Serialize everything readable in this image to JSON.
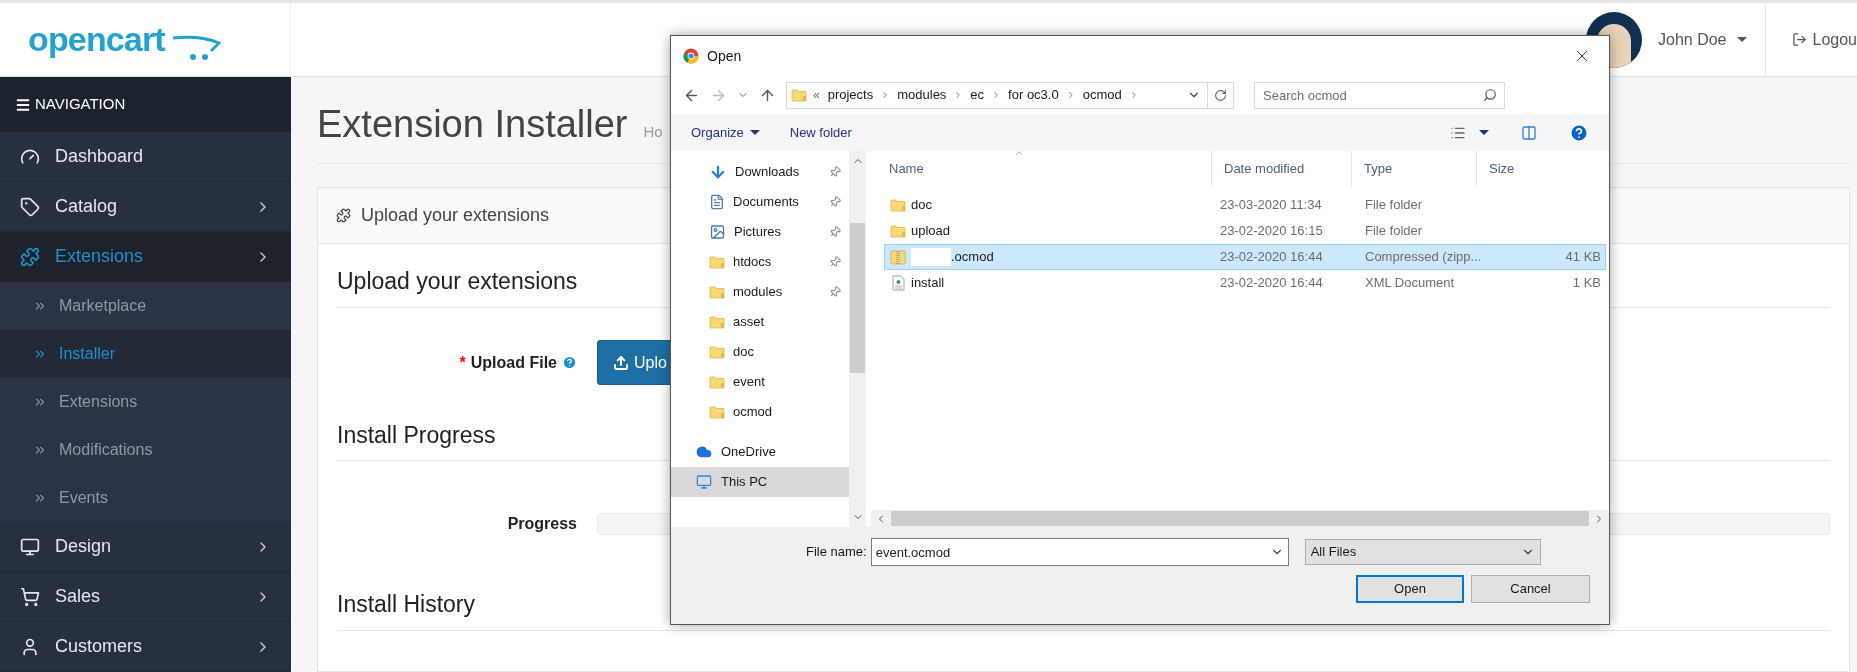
{
  "logo": {
    "text": "opencart"
  },
  "header": {
    "user": "John Doe",
    "logout": "Logou"
  },
  "sidebar": {
    "title": "NAVIGATION",
    "items": [
      {
        "label": "Dashboard",
        "kind": "dashboard",
        "has_submenu": false,
        "selected": false
      },
      {
        "label": "Catalog",
        "kind": "tag",
        "has_submenu": true,
        "selected": false
      },
      {
        "label": "Extensions",
        "kind": "puzzle",
        "has_submenu": true,
        "selected": true,
        "children": [
          {
            "label": "Marketplace",
            "selected": false
          },
          {
            "label": "Installer",
            "selected": true
          },
          {
            "label": "Extensions",
            "selected": false
          },
          {
            "label": "Modifications",
            "selected": false
          },
          {
            "label": "Events",
            "selected": false
          }
        ]
      },
      {
        "label": "Design",
        "kind": "monitor",
        "has_submenu": true,
        "selected": false
      },
      {
        "label": "Sales",
        "kind": "cart",
        "has_submenu": true,
        "selected": false
      },
      {
        "label": "Customers",
        "kind": "user",
        "has_submenu": true,
        "selected": false
      }
    ]
  },
  "page": {
    "title": "Extension Installer",
    "breadcrumb": "Ho",
    "panel_title": "Upload your extensions",
    "upload": {
      "legend": "Upload your extensions",
      "label": "Upload File",
      "required_mark": "*",
      "button": "Uplo"
    },
    "progress": {
      "legend": "Install Progress",
      "label": "Progress",
      "level": 0
    },
    "history": {
      "legend": "Install History"
    }
  },
  "dialog": {
    "title": "Open",
    "overflow_mark": "«",
    "path": [
      "projects",
      "modules",
      "ec",
      "for oc3.0",
      "ocmod"
    ],
    "search": {
      "placeholder": "Search ocmod"
    },
    "toolbar": [
      "Organize",
      "New folder"
    ],
    "nav": [
      {
        "label": "Downloads",
        "kind": "download",
        "pinned": true,
        "selected": false
      },
      {
        "label": "Documents",
        "kind": "documents",
        "pinned": true,
        "selected": false
      },
      {
        "label": "Pictures",
        "kind": "pictures",
        "pinned": true,
        "selected": false
      },
      {
        "label": "htdocs",
        "kind": "folder",
        "pinned": true,
        "selected": false
      },
      {
        "label": "modules",
        "kind": "folder",
        "pinned": true,
        "selected": false
      },
      {
        "label": "asset",
        "kind": "folder",
        "pinned": false,
        "selected": false
      },
      {
        "label": "doc",
        "kind": "folder",
        "pinned": false,
        "selected": false
      },
      {
        "label": "event",
        "kind": "folder",
        "pinned": false,
        "selected": false
      },
      {
        "label": "ocmod",
        "kind": "folder",
        "pinned": false,
        "selected": false
      },
      {
        "label": "OneDrive",
        "kind": "cloud",
        "pinned": false,
        "selected": false
      },
      {
        "label": "This PC",
        "kind": "pc",
        "pinned": false,
        "selected": true
      }
    ],
    "columns": [
      "Name",
      "Date modified",
      "Type",
      "Size"
    ],
    "rows": [
      {
        "name": "doc",
        "kind": "folder",
        "date": "23-03-2020 11:34",
        "type": "File folder",
        "selected": false
      },
      {
        "name": "upload",
        "kind": "folder",
        "date": "23-02-2020 16:15",
        "type": "File folder",
        "selected": false
      },
      {
        "name": ".ocmod",
        "kind": "zip",
        "redacted": true,
        "date": "23-02-2020 16:44",
        "type": "Compressed (zipp...",
        "size": "41 KB",
        "selected": true
      },
      {
        "name": "install",
        "kind": "xml",
        "date": "23-02-2020 16:44",
        "type": "XML Document",
        "size": "1 KB",
        "selected": false
      }
    ],
    "file_name_label": "File name:",
    "file_name": "event.ocmod",
    "filter": "All Files",
    "buttons": [
      "Open",
      "Cancel"
    ]
  }
}
